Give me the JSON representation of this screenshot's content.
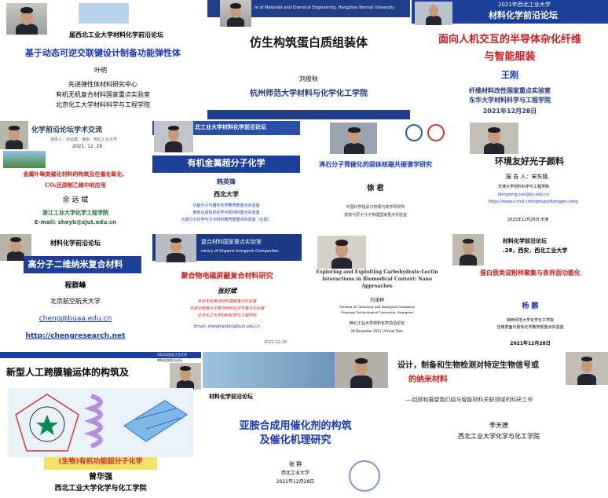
{
  "tiles": {
    "t1": {
      "header": "届西北工业大学材料化学前沿论坛",
      "title": "基于动态可逆交联键设计制备功能弹性体",
      "speaker": "叶明",
      "aff1": "先进弹性体材料研究中心",
      "aff2": "有机无机复合材料国家重点实验室",
      "aff3": "北京化工大学材料科学与工程学院"
    },
    "t2": {
      "header": "te of Materials and Chemical Engineering, Hangzhou Normal University",
      "title": "仿生构筑蛋白质组装体",
      "speaker": "刘俊秋",
      "aff": "杭州师范大学材料与化学化工学院"
    },
    "t3": {
      "header1": "2021年西北工业大学",
      "header2": "材料化学前沿论坛",
      "title1": "面向人机交互的半导体杂化纤维",
      "title2": "与智能服装",
      "speaker": "王刚",
      "aff1": "纤维材料改性国家重点实验室",
      "aff2": "东华大学材料科学与工程学院",
      "date": "2021年12月28日"
    },
    "t4": {
      "header": "化学前沿论坛学术交流",
      "sub": "演讲人：佘远斌，海安，西北工业大学",
      "date": "2021. 12. 28",
      "title1": "金属卟啉类催化材料的构筑及在催化氧化、",
      "title2": "CO₂还原制乙烯中的应用",
      "speaker": "佘 远 斌",
      "aff": "浙江工业大学化学工程学院",
      "email": "E-mail:  sheyb@zjut.edu.cn"
    },
    "t5": {
      "header": "北工业大学材料化学前沿论坛",
      "title": "有机金属超分子化学",
      "speaker": "韩英锋",
      "aff": "西北大学",
      "line1": "功能分子与器件化学教育部重点实验室",
      "line2": "西安合成有机化学与新材料重点实验室",
      "line3": "合成分子化学与分子材料教育部重点实验室（合成）"
    },
    "t6": {
      "title": "沸石分子筛催化的固体核磁共振谱学研究",
      "speaker": "徐 君",
      "aff1": "中国科学院武汉物理与数学研究所",
      "aff2": "波谱与原子分子物理国家重点实验室"
    },
    "t7": {
      "title": "环境友好光子颜料",
      "speaker": "报 告 人：宋东姚",
      "aff": "天津大学材料科学与工程学院",
      "email": "dongsong.sun@tju.edu.cn",
      "web": "https://www.x-mol.com/groups/donggen-song",
      "date": "2021年12月28日 天津"
    },
    "t8": {
      "header": "材料化学前沿论坛",
      "title": "高分子二维纳米复合材料",
      "speaker": "程群峰",
      "aff": "北京航空航天大学",
      "email": "cheng@buaa.edu.cn",
      "web": "http://chengresearch.net"
    },
    "t9": {
      "header1": "复合材料国家重点实验室",
      "header2": "ratory of Organic-Inorganic Composites",
      "title": "聚合物电磁屏蔽复合材料研究",
      "speaker": "张好斌",
      "aff1": "有机无机复合材料国家重点实验室",
      "aff2": "先进功能高分子复合材料北京市重点实验室",
      "aff3": "北京化工大学材料科学与工程学院",
      "email": "Email: zhanghaobin@buct.edu.cn",
      "date": "2021-12-28"
    },
    "t10": {
      "title1": "Exploring and Exploiting Carbohydrate-Lectin",
      "title2": "Interactions in Biomedical Context: Nano",
      "title3": "Approaches",
      "speaker": "刘泽林",
      "aff1": "Division of Chemistry and Biological Chemistry",
      "aff2": "Nanyang Technological University, Singapore",
      "aff3": "西北工业大学材料化学前沿论坛",
      "date": "28 December 2021 | Virtual Talks"
    },
    "t11": {
      "header1": "材料化学前沿论坛",
      "header2": ".28，西安，西北工业大学",
      "title": "蛋白质类淀粉样聚集与表界面功能化",
      "speaker": "杨 鹏",
      "aff1": "陕西师范大学化学化工学院",
      "aff2": "应用表面与胶体化学教育部重点实验室",
      "date": "2021年12月28日"
    },
    "t12": {
      "badge1": "2021年西北工业大学",
      "badge2": "材料化学前沿论坛",
      "title": "新型人工跨膜输运体的构筑及",
      "banner": "(生物)有机功能超分子化学",
      "speaker": "曾华强",
      "aff": "西北工业大学化学与化工学院"
    },
    "t13": {
      "header": "材料化学前沿论坛",
      "title1": "亚胺合成用催化剂的构筑",
      "title2": "及催化机理研究",
      "speaker": "张 群",
      "aff": "西北工业大学",
      "date": "2021年12月28日"
    },
    "t14": {
      "title1": "设计，制备和生物检测对特定生物信号或",
      "title2": "的纳米材料",
      "sub": "——回顾和展望我们组与智能材料关联领域的科研工作",
      "speaker": "李天德",
      "aff": "西北工业大学化学与化工学院"
    }
  },
  "colors": {
    "accent_red": "#cc1a1a",
    "accent_blue": "#1636b8",
    "navy": "#1f3a7a",
    "title_bar_blue": "#1c3f9a"
  }
}
